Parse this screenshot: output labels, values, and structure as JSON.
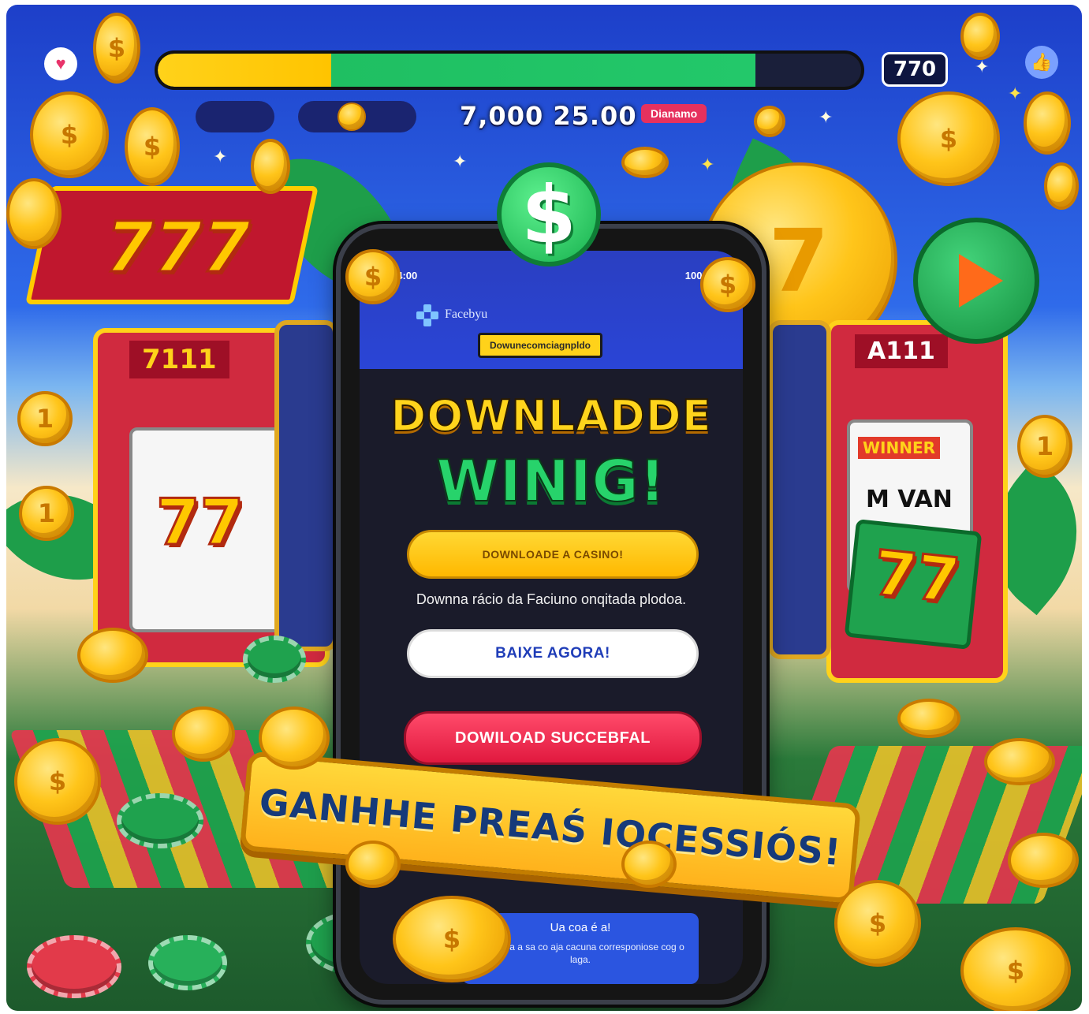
{
  "hud": {
    "progress_percent": 85,
    "counter": "770",
    "stat_value": "7,000 25.00",
    "stat_badge": "Dianamo"
  },
  "signs": {
    "left_777": "777",
    "left_machine_label": "7111",
    "left_reel_symbol": "77",
    "right_machine_label": "A111",
    "right_reel_label": "M VAN",
    "right_reel_symbol": "77",
    "right_top_label": "WINNER"
  },
  "phone": {
    "status_left": "14:00",
    "status_right": "100%",
    "app_name": "Facebyu",
    "tagline": "Dowunecomciagnpldo",
    "headline_line1": "DOWNLADDE",
    "headline_line2": "WINIG!",
    "btn_download_casino": "DOWNLOADE A CASINO!",
    "description": "Downna rácio da Faciuno onqitada plodoa.",
    "btn_baixe": "BAIXE AGORA!",
    "btn_success": "DOWILOAD SUCCEBFAL",
    "toast_title": "Ua coa é a!",
    "toast_body": "Dvara ba a sa co aja cacuna corresponiose cog o laga."
  },
  "banner": {
    "text": "GANHHE PREAŚ IOCESSIÓS!"
  },
  "icons": {
    "heart": "heart-icon",
    "thumb": "thumbs-up-icon",
    "dollar": "dollar-icon",
    "play": "play-icon"
  },
  "colors": {
    "sky": "#2f6bea",
    "gold": "#ffc51a",
    "green": "#23c86a",
    "red": "#e1193f"
  }
}
